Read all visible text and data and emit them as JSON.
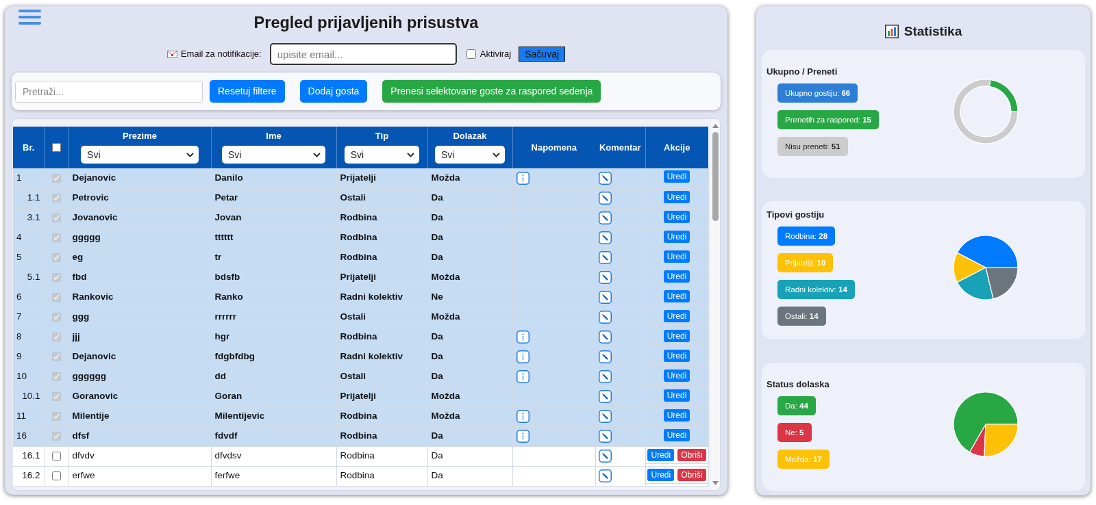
{
  "header": {
    "title": "Pregled prijavljenih prisustva"
  },
  "notification": {
    "label": "Email za notifikacije:",
    "email_field": {
      "placeholder": "upisite email..."
    },
    "activate": {
      "label": "Aktiviraj",
      "checked": false
    },
    "save_button": "Sačuvaj"
  },
  "toolbar": {
    "search": {
      "placeholder": "Pretraži..."
    },
    "buttons": [
      {
        "label": "Resetuj filtere",
        "kind": "primary"
      },
      {
        "label": "Dodaj gosta",
        "kind": "primary"
      },
      {
        "label": "Prenesi selektovane goste za raspored sedenja",
        "kind": "success"
      }
    ]
  },
  "table": {
    "columns": [
      {
        "kind": "text",
        "label": "Br."
      },
      {
        "kind": "checkbox",
        "checked": false
      },
      {
        "kind": "filter",
        "label": "Prezime",
        "filter": "Svi"
      },
      {
        "kind": "filter",
        "label": "Ime",
        "filter": "Svi"
      },
      {
        "kind": "filter",
        "label": "Tip",
        "filter": "Svi"
      },
      {
        "kind": "filter",
        "label": "Dolazak",
        "filter": "Svi"
      },
      {
        "kind": "text",
        "label": "Napomena"
      },
      {
        "kind": "text",
        "label": "Komentar"
      },
      {
        "kind": "text",
        "label": "Akcije"
      }
    ],
    "rows": [
      {
        "number": "1",
        "kind": "guest",
        "selected": true,
        "last_name": "Dejanovic",
        "first_name": "Danilo",
        "type": "Prijatelji",
        "arrival": "Možda",
        "note": true,
        "actions": [
          {
            "label": "Uredi",
            "kind": "edit"
          }
        ]
      },
      {
        "number": "1.1",
        "kind": "companion",
        "selected": true,
        "last_name": "Petrovic",
        "first_name": "Petar",
        "type": "Ostali",
        "arrival": "Da",
        "note": false,
        "actions": [
          {
            "label": "Uredi",
            "kind": "edit"
          }
        ]
      },
      {
        "number": "3.1",
        "kind": "companion",
        "selected": true,
        "last_name": "Jovanovic",
        "first_name": "Jovan",
        "type": "Rodbina",
        "arrival": "Da",
        "note": false,
        "actions": [
          {
            "label": "Uredi",
            "kind": "edit"
          }
        ]
      },
      {
        "number": "4",
        "kind": "guest",
        "selected": true,
        "last_name": "ggggg",
        "first_name": "tttttt",
        "type": "Rodbina",
        "arrival": "Da",
        "note": false,
        "actions": [
          {
            "label": "Uredi",
            "kind": "edit"
          }
        ]
      },
      {
        "number": "5",
        "kind": "guest",
        "selected": true,
        "last_name": "eg",
        "first_name": "tr",
        "type": "Rodbina",
        "arrival": "Da",
        "note": false,
        "actions": [
          {
            "label": "Uredi",
            "kind": "edit"
          }
        ]
      },
      {
        "number": "5.1",
        "kind": "companion",
        "selected": true,
        "last_name": "fbd",
        "first_name": "bdsfb",
        "type": "Prijatelji",
        "arrival": "Možda",
        "note": false,
        "actions": [
          {
            "label": "Uredi",
            "kind": "edit"
          }
        ]
      },
      {
        "number": "6",
        "kind": "guest",
        "selected": true,
        "last_name": "Rankovic",
        "first_name": "Ranko",
        "type": "Radni kolektiv",
        "arrival": "Ne",
        "note": false,
        "actions": [
          {
            "label": "Uredi",
            "kind": "edit"
          }
        ]
      },
      {
        "number": "7",
        "kind": "guest",
        "selected": true,
        "last_name": "ggg",
        "first_name": "rrrrrr",
        "type": "Ostali",
        "arrival": "Možda",
        "note": false,
        "actions": [
          {
            "label": "Uredi",
            "kind": "edit"
          }
        ]
      },
      {
        "number": "8",
        "kind": "guest",
        "selected": true,
        "last_name": "jjj",
        "first_name": "hgr",
        "type": "Rodbina",
        "arrival": "Da",
        "note": true,
        "actions": [
          {
            "label": "Uredi",
            "kind": "edit"
          }
        ]
      },
      {
        "number": "9",
        "kind": "guest",
        "selected": true,
        "last_name": "Dejanovic",
        "first_name": "fdgbfdbg",
        "type": "Radni kolektiv",
        "arrival": "Da",
        "note": true,
        "actions": [
          {
            "label": "Uredi",
            "kind": "edit"
          }
        ]
      },
      {
        "number": "10",
        "kind": "guest",
        "selected": true,
        "last_name": "gggggg",
        "first_name": "dd",
        "type": "Ostali",
        "arrival": "Da",
        "note": true,
        "actions": [
          {
            "label": "Uredi",
            "kind": "edit"
          }
        ]
      },
      {
        "number": "10.1",
        "kind": "companion",
        "selected": true,
        "last_name": "Goranovic",
        "first_name": "Goran",
        "type": "Prijatelji",
        "arrival": "Možda",
        "note": false,
        "actions": [
          {
            "label": "Uredi",
            "kind": "edit"
          }
        ]
      },
      {
        "number": "11",
        "kind": "guest",
        "selected": true,
        "last_name": "Milentije",
        "first_name": "Milentijevic",
        "type": "Rodbina",
        "arrival": "Možda",
        "note": true,
        "actions": [
          {
            "label": "Uredi",
            "kind": "edit"
          }
        ]
      },
      {
        "number": "16",
        "kind": "guest",
        "selected": true,
        "last_name": "dfsf",
        "first_name": "fdvdf",
        "type": "Rodbina",
        "arrival": "Da",
        "note": true,
        "actions": [
          {
            "label": "Uredi",
            "kind": "edit"
          }
        ]
      },
      {
        "number": "16.1",
        "kind": "companion",
        "selected": false,
        "last_name": "dfvdv",
        "first_name": "dfvdsv",
        "type": "Rodbina",
        "arrival": "Da",
        "note": false,
        "actions": [
          {
            "label": "Uredi",
            "kind": "edit"
          },
          {
            "label": "Obriši",
            "kind": "delete"
          }
        ]
      },
      {
        "number": "16.2",
        "kind": "companion",
        "selected": false,
        "last_name": "erfwe",
        "first_name": "ferfwe",
        "type": "Rodbina",
        "arrival": "Da",
        "note": false,
        "actions": [
          {
            "label": "Uredi",
            "kind": "edit"
          },
          {
            "label": "Obriši",
            "kind": "delete"
          }
        ]
      }
    ]
  },
  "statistics": {
    "title": "Statistika",
    "cards": [
      {
        "title": "Ukupno / Preneti",
        "badges": [
          {
            "text": "Ukupno gostiju: **66**",
            "color": "#2d7fd5"
          },
          {
            "text": "Prenetih za raspored: **15**",
            "color": "#28a745"
          },
          {
            "text": "Nisu preneti: **51**",
            "color": "#cccccc"
          }
        ],
        "chart_data": {
          "type": "donut",
          "values": [
            22.7,
            77.3
          ],
          "colors": [
            "#28a745",
            "#cccccc"
          ]
        }
      },
      {
        "title": "Tipovi gostiju",
        "badges": [
          {
            "text": "Rodbina: **28**",
            "color": "#007bff"
          },
          {
            "text": "Prijatelji: **10**",
            "color": "#ffc107"
          },
          {
            "text": "Radni kolektiv: **14**",
            "color": "#17a2b8"
          },
          {
            "text": "Ostali: **14**",
            "color": "#6c757d"
          }
        ],
        "chart_data": {
          "type": "pie",
          "values": [
            42.4,
            15.2,
            21.2,
            21.2
          ],
          "colors": [
            "#007bff",
            "#ffc107",
            "#17a2b8",
            "#6c757d"
          ]
        }
      },
      {
        "title": "Status dolaska",
        "badges": [
          {
            "text": "Da: **44**",
            "color": "#28a745"
          },
          {
            "text": "Ne: **5**",
            "color": "#dc3545"
          },
          {
            "text": "Možda: **17**",
            "color": "#ffc107"
          }
        ],
        "chart_data": {
          "type": "pie",
          "values": [
            66.7,
            7.6,
            25.7
          ],
          "colors": [
            "#28a745",
            "#dc3545",
            "#ffc107"
          ]
        }
      }
    ]
  }
}
